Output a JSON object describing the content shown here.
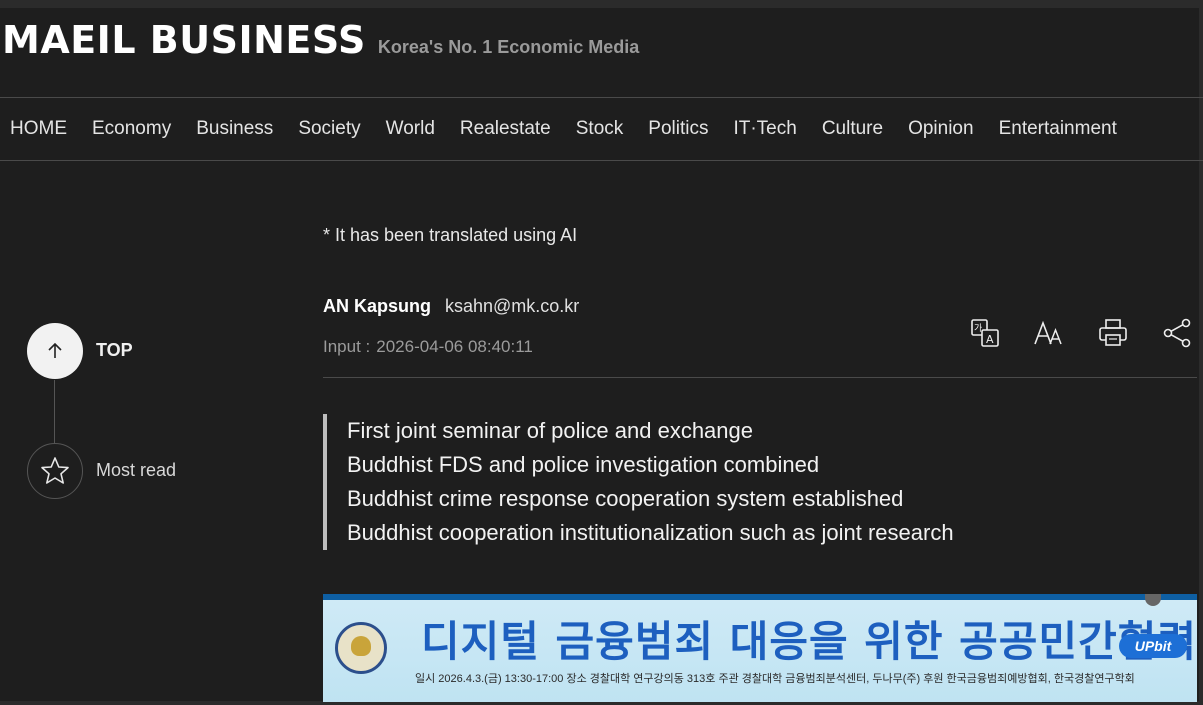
{
  "header": {
    "logo": "MAEIL BUSINESS",
    "tagline": "Korea's No. 1 Economic Media"
  },
  "nav": {
    "items": [
      "HOME",
      "Economy",
      "Business",
      "Society",
      "World",
      "Realestate",
      "Stock",
      "Politics",
      "IT·Tech",
      "Culture",
      "Opinion",
      "Entertainment"
    ]
  },
  "sidebar": {
    "top_label": "TOP",
    "most_read_label": "Most read"
  },
  "article": {
    "notice": "* It has been translated using AI",
    "author_name": "AN Kapsung",
    "author_email": "ksahn@mk.co.kr",
    "input_label": "Input :",
    "input_time": "2026-04-06 08:40:11",
    "summary": [
      "First joint seminar of police and exchange",
      "Buddhist FDS and police investigation combined",
      "Buddhist crime response cooperation system established",
      "Buddhist cooperation institutionalization such as joint research"
    ],
    "tools": [
      "translate-icon",
      "font-size-icon",
      "print-icon",
      "share-icon"
    ]
  },
  "banner": {
    "title": "디지털 금융범죄 대응을 위한 공공민간협력 세미나",
    "info": "일시 2026.4.3.(금) 13:30-17:00   장소 경찰대학 연구강의동 313호   주관 경찰대학 금융범죄분석센터, 두나무(주)   후원 한국금융범죄예방협회, 한국경찰연구학회",
    "logo": "UPbit"
  }
}
